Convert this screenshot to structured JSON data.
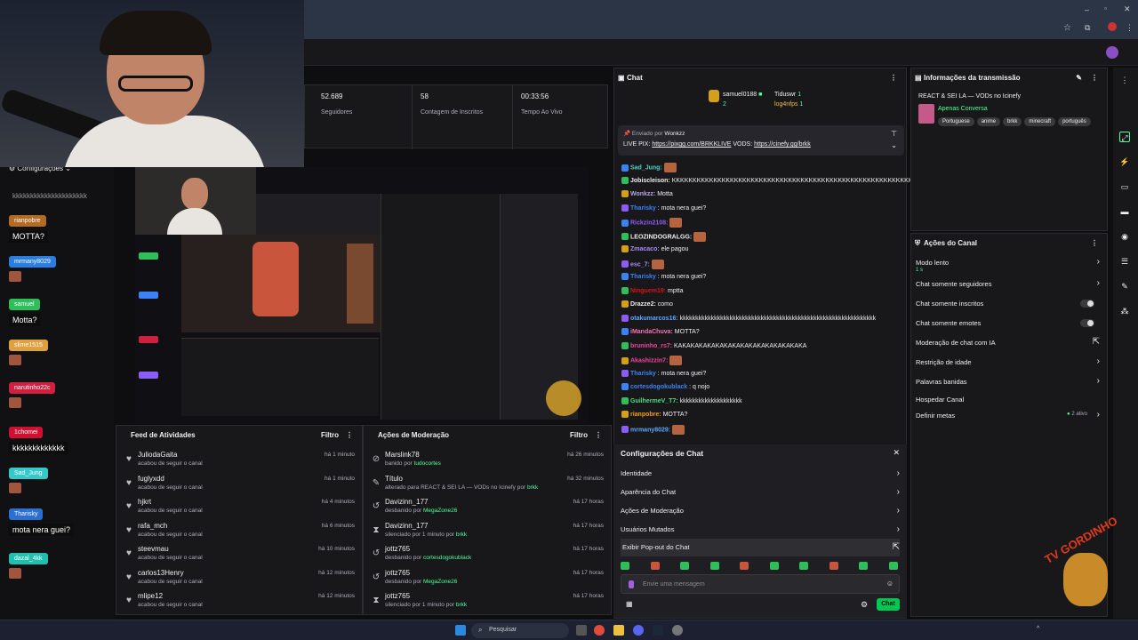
{
  "left_chat": {
    "config_label": "Configurações",
    "spam": "kkkkkkkkkkkkkkkkkkkkk",
    "items": [
      {
        "user": "rianpobre",
        "color": "#b26b25",
        "msg": "MOTTA?"
      },
      {
        "user": "mrmany8029",
        "color": "#2a7de1",
        "msg": ""
      },
      {
        "user": "samuel",
        "color": "#2fbf5a",
        "msg": "Motta?"
      },
      {
        "user": "slime1515",
        "color": "#e0a040",
        "msg": ""
      },
      {
        "user": "narutinho22c",
        "color": "#d02040",
        "msg": ""
      },
      {
        "user": "1chomei",
        "color": "#d01030",
        "msg": "kkkkkkkkkkkkk"
      },
      {
        "user": "Sad_Jung",
        "color": "#35c9c9",
        "msg": ""
      },
      {
        "user": "Tharisky",
        "color": "#2a6fd1",
        "msg": "mota nera guei?"
      },
      {
        "user": "dazal_4kk",
        "color": "#20c0b0",
        "msg": ""
      }
    ]
  },
  "stats": [
    {
      "value": "52.689",
      "label": "Seguidores"
    },
    {
      "value": "58",
      "label": "Contagem de Inscritos"
    },
    {
      "value": "00:33:56",
      "label": "Tempo Ao Vivo"
    }
  ],
  "feed": {
    "title": "Feed de Atividades",
    "filter": "Filtro",
    "rows": [
      {
        "name": "JuliodaGaita",
        "sub": "acabou de seguir o canal",
        "time": "há 1 minuto"
      },
      {
        "name": "fuglyxdd",
        "sub": "acabou de seguir o canal",
        "time": "há 1 minuto"
      },
      {
        "name": "hjkrt",
        "sub": "acabou de seguir o canal",
        "time": "há 4 minutos"
      },
      {
        "name": "rafa_mch",
        "sub": "acabou de seguir o canal",
        "time": "há 6 minutos"
      },
      {
        "name": "steevmau",
        "sub": "acabou de seguir o canal",
        "time": "há 10 minutos"
      },
      {
        "name": "carlos13Henry",
        "sub": "acabou de seguir o canal",
        "time": "há 12 minutos"
      },
      {
        "name": "mlipe12",
        "sub": "acabou de seguir o canal",
        "time": "há 12 minutos"
      }
    ]
  },
  "mod": {
    "title": "Ações de Moderação",
    "filter": "Filtro",
    "rows": [
      {
        "icon": "⊘",
        "name": "Marslink78",
        "sub": "banido por",
        "by": "tudocortes",
        "time": "há 26 minutos"
      },
      {
        "icon": "✎",
        "name": "Título",
        "sub": "alterado para REACT & SEI LA — VODs no Icinefy por",
        "by": "brkk",
        "time": "há 32 minutos"
      },
      {
        "icon": "↺",
        "name": "Davizinn_177",
        "sub": "desbanido por",
        "by": "MegaZone26",
        "time": "há 17 horas"
      },
      {
        "icon": "⧗",
        "name": "Davizinn_177",
        "sub": "silenciado por 1 minuto por",
        "by": "brkk",
        "time": "há 17 horas"
      },
      {
        "icon": "↺",
        "name": "jottz765",
        "sub": "desbanido por",
        "by": "cortesdogokublack",
        "time": "há 17 horas"
      },
      {
        "icon": "↺",
        "name": "jottz765",
        "sub": "desbanido por",
        "by": "MegaZone26",
        "time": "há 17 horas"
      },
      {
        "icon": "⧗",
        "name": "jottz765",
        "sub": "silenciado por 1 minuto por",
        "by": "brkk",
        "time": "há 17 horas"
      }
    ]
  },
  "chat": {
    "title": "Chat",
    "leaders": [
      {
        "name": "samuel0188",
        "count": "2"
      },
      {
        "name": "Tiduswr",
        "count": "1"
      },
      {
        "name": "log4nfps",
        "count": "1"
      }
    ],
    "pinned_by_label": "Enviado por",
    "pinned_by": "Wonkzz",
    "pinned_text": "LIVE PIX:",
    "pinned_link1": "https://pixgg.com/BRKKLIVE",
    "pinned_mid": "VODS:",
    "pinned_link2": "https://cinefy.gg/brkk",
    "lines": [
      {
        "user": "Sad_Jung:",
        "color": "#4fd1c5",
        "msg": "",
        "emote": true
      },
      {
        "user": "Jobiscleison:",
        "color": "#efeff1",
        "msg": "KKKKKKKKKKKKKKKKKKKKKKKKKKKKKKKKKKKKKKKKKKKKKKKKKKKKKKKKKKKK",
        "emote": false
      },
      {
        "user": "Wonkzz:",
        "color": "#b9a3e3",
        "msg": "Motta",
        "emote": false
      },
      {
        "user": "Tharisky",
        "color": "#3b82f6",
        "msg": ": mota nera guei?",
        "emote": false
      },
      {
        "user": "Rickzin2108:",
        "color": "#8b5cf6",
        "msg": "",
        "emote": true
      },
      {
        "user": "LEOZINDOGRALGG:",
        "color": "#efeff1",
        "msg": "",
        "emote": true
      },
      {
        "user": "Zmacaco:",
        "color": "#a78bfa",
        "msg": "ele pagou",
        "emote": false
      },
      {
        "user": "esc_7:",
        "color": "#a78bfa",
        "msg": "",
        "emote": true
      },
      {
        "user": "Tharisky",
        "color": "#3b82f6",
        "msg": ": mota nera guei?",
        "emote": false
      },
      {
        "user": "Ninguem19:",
        "color": "#d11",
        "msg": "mptta",
        "emote": false
      },
      {
        "user": "Drazze2:",
        "color": "#efeff1",
        "msg": "como",
        "emote": false
      },
      {
        "user": "otakumarcos16:",
        "color": "#60a5fa",
        "msg": "kkkkkkkkkkkkkkkkkkkkkkkkkkkkkkkkkkkkkkkkkkkkkkkkkkkkkkkkkkkkkkk",
        "emote": false
      },
      {
        "user": "iMandaChuva:",
        "color": "#f472b6",
        "msg": "MOTTA?",
        "emote": false
      },
      {
        "user": "bruninho_rs7:",
        "color": "#ec4899",
        "msg": "KAKAKAKAKAKAKAKAKAKAKAKAKAKAKAKA",
        "emote": false
      },
      {
        "user": "Akashizzin7:",
        "color": "#ec4899",
        "msg": "",
        "emote": true
      },
      {
        "user": "Tharisky",
        "color": "#3b82f6",
        "msg": ": mota nera guei?",
        "emote": false
      },
      {
        "user": "cortesdogokublack",
        "color": "#3b82f6",
        "msg": ": q nojo",
        "emote": false
      },
      {
        "user": "GuilhermeV_T7:",
        "color": "#4ade80",
        "msg": "kkkkkkkkkkkkkkkkkkkk",
        "emote": false
      },
      {
        "user": "rianpobre:",
        "color": "#f59e0b",
        "msg": "MOTTA?",
        "emote": false
      },
      {
        "user": "mrmany8029:",
        "color": "#60a5fa",
        "msg": "",
        "emote": true
      }
    ],
    "config_title": "Configurações de Chat",
    "config_items": [
      "Identidade",
      "Aparência do Chat",
      "Ações de Moderação",
      "Usuários Mutados",
      "Exibir Pop-out do Chat"
    ],
    "input_placeholder": "Envie uma mensagem",
    "send_label": "Chat"
  },
  "info": {
    "title": "Informações da transmissão",
    "stream_title": "REACT & SEI LA — VODs no Icinefy",
    "category": "Apenas Conversa",
    "tags": [
      "Portuguese",
      "anime",
      "brkk",
      "minecraft",
      "português"
    ]
  },
  "acoes": {
    "title": "Ações do Canal",
    "items": [
      {
        "label": "Modo lento",
        "sub": "1 s",
        "kind": "chevron"
      },
      {
        "label": "Chat somente seguidores",
        "kind": "chevron"
      },
      {
        "label": "Chat somente inscritos",
        "kind": "toggle"
      },
      {
        "label": "Chat somente emotes",
        "kind": "toggle"
      },
      {
        "label": "Moderação de chat com IA",
        "kind": "external"
      },
      {
        "label": "Restrição de idade",
        "kind": "chevron"
      },
      {
        "label": "Palavras banidas",
        "kind": "chevron"
      },
      {
        "label": "Hospedar Canal",
        "kind": "none"
      },
      {
        "label": "Definir metas",
        "kind": "chevron",
        "badge": "2 ativo"
      }
    ]
  },
  "taskbar": {
    "search": "Pesquisar"
  },
  "watermark": "TV GORDINHO"
}
